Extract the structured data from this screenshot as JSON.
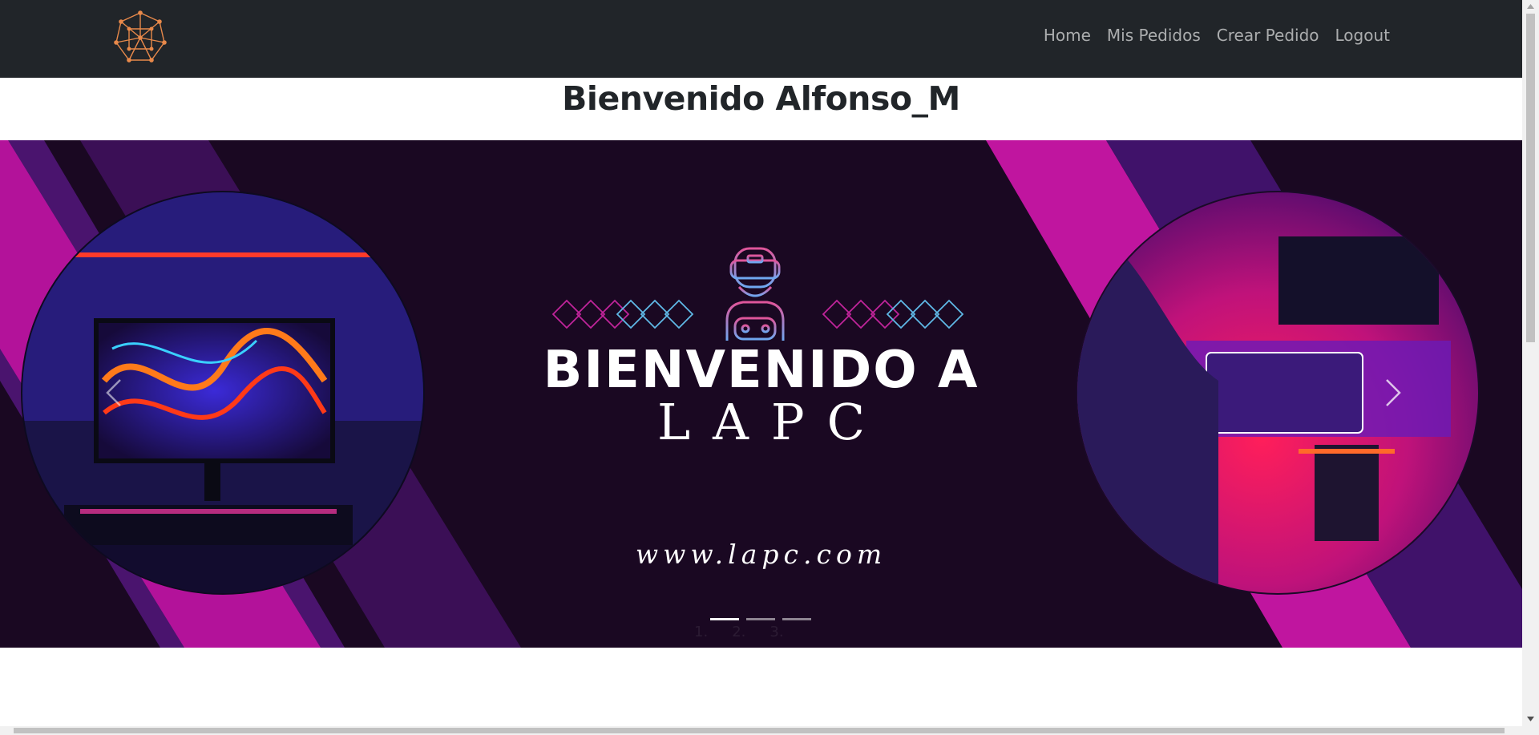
{
  "nav": {
    "items": [
      {
        "label": "Home"
      },
      {
        "label": "Mis Pedidos"
      },
      {
        "label": "Crear Pedido"
      },
      {
        "label": "Logout"
      }
    ]
  },
  "page": {
    "title": "Bienvenido Alfonso_M"
  },
  "carousel": {
    "slide": {
      "headline": "BIENVENIDO A",
      "brand": "LAPC",
      "url": "www.lapc.com"
    },
    "indicators": [
      "1.",
      "2.",
      "3."
    ],
    "active_index": 0
  },
  "colors": {
    "navbar": "#212529",
    "banner_bg": "#1a0822",
    "accent_magenta": "#c2189c",
    "accent_purple": "#3a0f5a",
    "logo": "#e8894a"
  }
}
